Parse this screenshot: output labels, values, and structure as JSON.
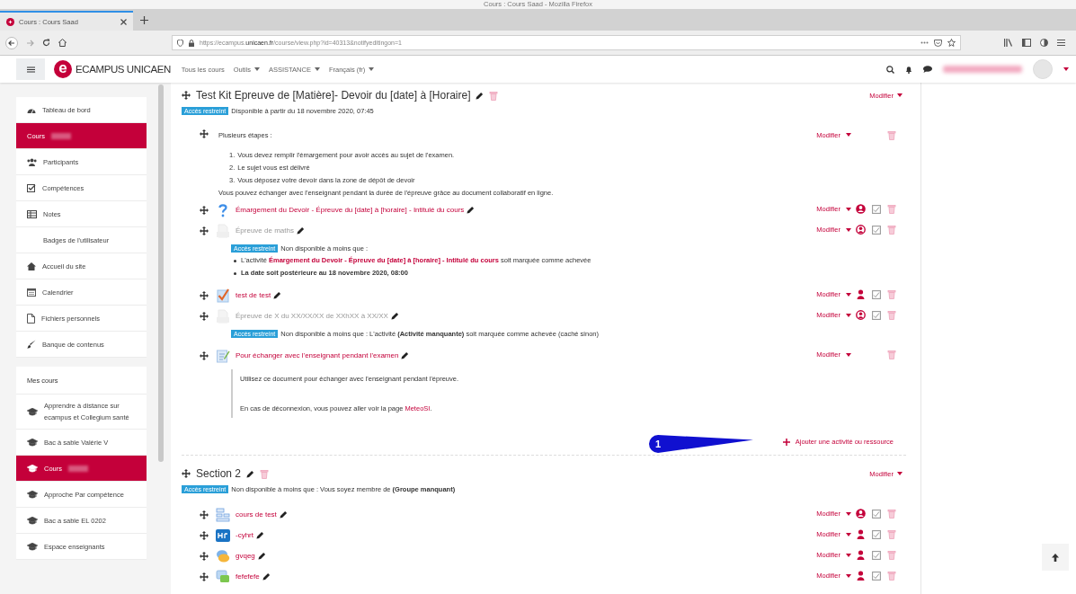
{
  "browser": {
    "window_title": "Cours : Cours Saad - Mozilla Firefox",
    "tab": {
      "label": "Cours : Cours Saad"
    },
    "url": "https://ecampus.**unicaen.fr**/course/view.php?id=40313&notifyeditingon=1"
  },
  "navbar": {
    "logo_letter": "e",
    "brand": "ECAMPUS UNICAEN",
    "menu": [
      {
        "label": "Tous les cours",
        "dropdown": false
      },
      {
        "label": "Outils",
        "dropdown": true
      },
      {
        "label": "ASSISTANCE",
        "dropdown": true
      },
      {
        "label": "Français (fr)",
        "dropdown": true
      }
    ]
  },
  "sidebar": {
    "nav": [
      {
        "label": "Tableau de bord",
        "selected": false
      },
      {
        "label": "Cours",
        "selected": true
      },
      {
        "label": "Participants",
        "selected": false
      },
      {
        "label": "Compétences",
        "selected": false
      },
      {
        "label": "Notes",
        "selected": false
      },
      {
        "label": "Badges de l'utilisateur",
        "selected": false
      },
      {
        "label": "Accueil du site",
        "selected": false
      },
      {
        "label": "Calendrier",
        "selected": false
      },
      {
        "label": "Fichiers personnels",
        "selected": false
      },
      {
        "label": "Banque de contenus",
        "selected": false
      }
    ],
    "my_courses": {
      "heading": "Mes cours",
      "items": [
        {
          "label": "Apprendre à distance sur ecampus et Collegium santé",
          "selected": false
        },
        {
          "label": "Bac à sable Valérie V",
          "selected": false
        },
        {
          "label": "Cours",
          "selected": true
        },
        {
          "label": "Approche Par compétence",
          "selected": false
        },
        {
          "label": "Bac a sable EL 0202",
          "selected": false
        },
        {
          "label": "Espace enseignants",
          "selected": false
        }
      ]
    }
  },
  "sections": [
    {
      "title": "Test Kit Epreuve de [Matière]- Devoir du [date] à [Horaire]",
      "modifier": "Modifier",
      "restriction": {
        "badge": "Accès restreint",
        "text": "Disponible à partir du 18 novembre 2020, 07:45"
      },
      "activities": [
        {
          "kind": "label",
          "intro": "Plusieurs étapes :",
          "steps": [
            {
              "number": "1.",
              "text": "Vous devez remplir l'émargement pour avoir accès au sujet de l'examen."
            },
            {
              "number": "2.",
              "text": "Le sujet vous est délivré"
            },
            {
              "number": "3.",
              "text": "Vous déposez votre devoir dans la zone de dépôt de devoir"
            }
          ],
          "note": "Vous pouvez échanger avec l'enseignant pendant la durée de l'épreuve grâce au document collaboratif en ligne.",
          "controls": {
            "modifier": "Modifier",
            "completion": false
          }
        },
        {
          "kind": "feedback",
          "name": "Émargement du Devoir - Épreuve du [date] à [horaire] - Intitulé du cours",
          "hidden": false,
          "controls": {
            "modifier": "Modifier",
            "group": {
              "kind": "separate"
            },
            "completion": true
          }
        },
        {
          "kind": "assign",
          "name": "Épreuve de maths",
          "hidden": true,
          "controls": {
            "modifier": "Modifier",
            "group": {
              "kind": "visible"
            },
            "completion": true
          },
          "restriction": {
            "badge": "Accès restreint",
            "text": "Non disponible à moins que :",
            "conditions": [
              {
                "kind": "activity",
                "prefix": "L'activité ",
                "link": "Émargement du Devoir - Épreuve du [date] à [horaire] - Intitulé du cours",
                "suffix": " soit marquée comme achevée"
              },
              {
                "kind": "date",
                "text": "La date soit postérieure au 18 novembre 2020, 08:00"
              }
            ]
          }
        },
        {
          "kind": "quiz",
          "name": "test de test",
          "hidden": false,
          "controls": {
            "modifier": "Modifier",
            "group": {
              "kind": "none"
            },
            "completion": true
          }
        },
        {
          "kind": "assign",
          "name": "Épreuve de X du XX/XX/XX de XXhXX à XX/XX",
          "hidden": true,
          "controls": {
            "modifier": "Modifier",
            "group": {
              "kind": "visible"
            },
            "completion": true
          },
          "restriction": {
            "badge": "Accès restreint",
            "text": "Non disponible à moins que : L'activité **(Activité manquante)** soit marquée comme achevée (caché sinon)"
          }
        },
        {
          "kind": "pad",
          "name": "Pour échanger avec l'enseignant pendant l'examen",
          "hidden": false,
          "controls": {
            "modifier": "Modifier",
            "completion": false
          },
          "description": [
            {
              "text": "Utilisez ce document pour échanger avec l'enseignant pendant l'épreuve."
            },
            {
              "text": "En cas de déconnexion, vous pouvez aller voir la page ",
              "link": "MeteoSI",
              "after": "."
            }
          ]
        }
      ],
      "add_link": "Ajouter une activité ou ressource",
      "callout": "1"
    },
    {
      "title": "Section 2",
      "modifier": "Modifier",
      "restriction": {
        "badge": "Accès restreint",
        "text": "Non disponible à moins que : Vous soyez membre de **(Groupe manquant)**"
      },
      "activities": [
        {
          "kind": "book",
          "name": "cours de test",
          "hidden": false,
          "controls": {
            "modifier": "Modifier",
            "group": {
              "kind": "separate"
            },
            "completion": true
          }
        },
        {
          "kind": "h5p",
          "name": "-cyhrt",
          "hidden": false,
          "controls": {
            "modifier": "Modifier",
            "group": {
              "kind": "none"
            },
            "completion": true
          }
        },
        {
          "kind": "chat",
          "name": "gvqeg",
          "hidden": false,
          "controls": {
            "modifier": "Modifier",
            "group": {
              "kind": "none"
            },
            "completion": true
          }
        },
        {
          "kind": "forum",
          "name": "fefefefe",
          "hidden": false,
          "controls": {
            "modifier": "Modifier",
            "group": {
              "kind": "none"
            },
            "completion": true
          }
        }
      ]
    }
  ]
}
